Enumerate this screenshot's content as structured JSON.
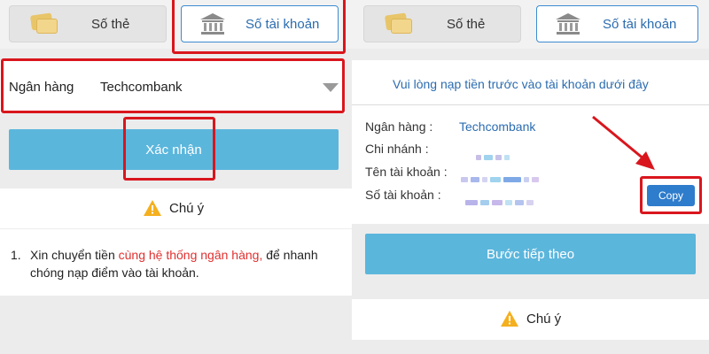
{
  "left": {
    "tabs": {
      "card_label": "Số thẻ",
      "account_label": "Số tài khoản"
    },
    "bank_field": {
      "label": "Ngân hàng",
      "value": "Techcombank"
    },
    "confirm_label": "Xác nhận",
    "warning_label": "Chú ý",
    "note": {
      "number": "1.",
      "text_before": "Xin chuyển tiền ",
      "text_highlight": "cùng hệ thống ngân hàng,",
      "text_after": " để nhanh chóng nạp điểm vào tài khoản."
    }
  },
  "right": {
    "tabs": {
      "card_label": "Số thẻ",
      "account_label": "Số tài khoản"
    },
    "instruction": "Vui lòng nạp tiền trước vào tài khoản dưới đây",
    "fields": {
      "bank_label": "Ngân hàng :",
      "bank_value": "Techcombank",
      "branch_label": "Chi nhánh :",
      "account_name_label": "Tên tài khoản :",
      "account_number_label": "Số tài khoản :"
    },
    "copy_label": "Copy",
    "next_label": "Bước tiếp theo",
    "warning_label": "Chú ý"
  },
  "colors": {
    "highlight_red": "#d9161d",
    "button_blue": "#5bb6dc",
    "link_blue": "#2b6cb0",
    "copy_blue": "#2e7ccc",
    "note_red": "#e0302f"
  },
  "icons": [
    "card-icon",
    "bank-icon",
    "warning-icon",
    "dropdown-caret-icon",
    "red-arrow-icon"
  ]
}
